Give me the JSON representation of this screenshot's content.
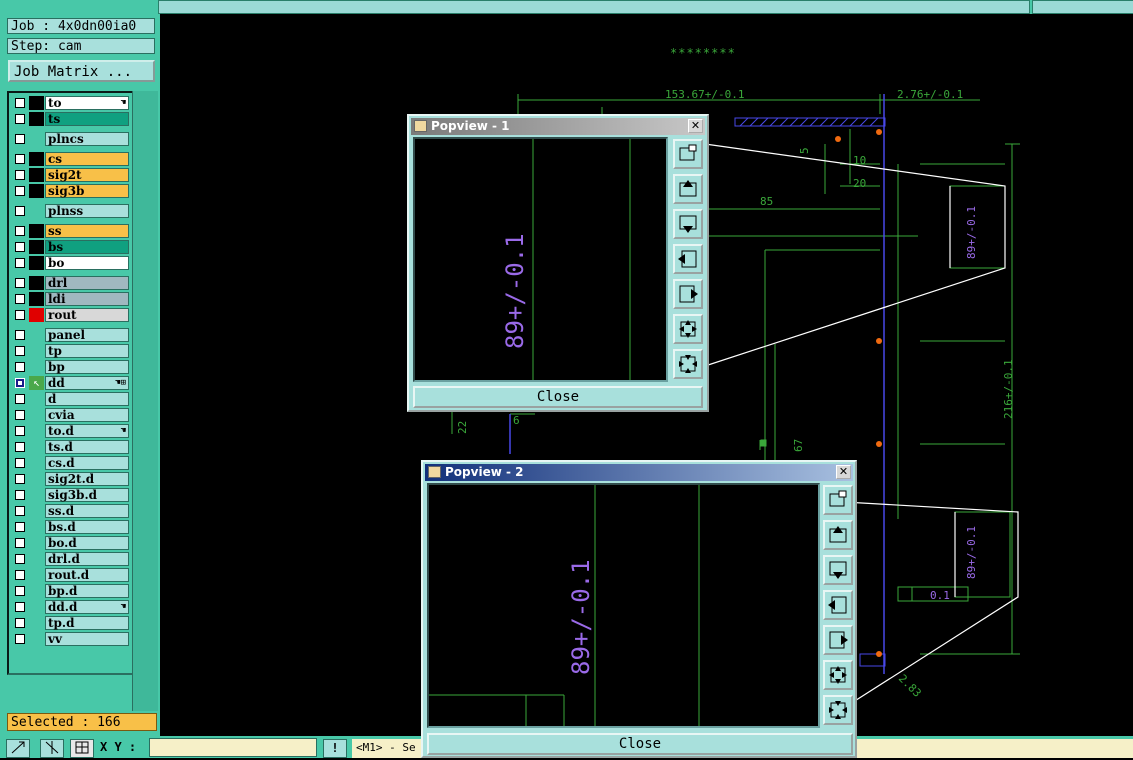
{
  "header": {
    "job": "Job : 4x0dn00ia0",
    "step": "Step: cam",
    "job_matrix": "Job Matrix ..."
  },
  "layers": [
    {
      "name": "to",
      "color": "#ffffff",
      "mark": "black",
      "tail": "hand"
    },
    {
      "name": "ts",
      "color": "#10a080",
      "mark": "black",
      "tail": ""
    },
    {
      "name": "plncs",
      "color": "#a8e0dc",
      "mark": "none",
      "tail": ""
    },
    {
      "name": "cs",
      "color": "#f8c048",
      "mark": "black",
      "tail": ""
    },
    {
      "name": "sig2t",
      "color": "#f8c048",
      "mark": "black",
      "tail": ""
    },
    {
      "name": "sig3b",
      "color": "#f8c048",
      "mark": "black",
      "tail": ""
    },
    {
      "name": "plnss",
      "color": "#a8e0dc",
      "mark": "none",
      "tail": ""
    },
    {
      "name": "ss",
      "color": "#f8c048",
      "mark": "black",
      "tail": ""
    },
    {
      "name": "bs",
      "color": "#10a080",
      "mark": "black",
      "tail": ""
    },
    {
      "name": "bo",
      "color": "#ffffff",
      "mark": "black",
      "tail": ""
    },
    {
      "name": "drl",
      "color": "#a0b8c0",
      "mark": "black",
      "tail": ""
    },
    {
      "name": "ldi",
      "color": "#a0b8c0",
      "mark": "black",
      "tail": ""
    },
    {
      "name": "rout",
      "color": "#d8d8d8",
      "mark": "red",
      "tail": ""
    },
    {
      "name": "panel",
      "color": "#a8e0dc",
      "mark": "none",
      "tail": ""
    },
    {
      "name": "tp",
      "color": "#a8e0dc",
      "mark": "none",
      "tail": ""
    },
    {
      "name": "bp",
      "color": "#a8e0dc",
      "mark": "none",
      "tail": ""
    },
    {
      "name": "dd",
      "color": "#a8e0dc",
      "mark": "arrow",
      "tail": "hand-grid",
      "selected": true
    },
    {
      "name": "d",
      "color": "#a8e0dc",
      "mark": "none",
      "tail": ""
    },
    {
      "name": "cvia",
      "color": "#a8e0dc",
      "mark": "none",
      "tail": ""
    },
    {
      "name": "to.d",
      "color": "#a8e0dc",
      "mark": "none",
      "tail": "hand"
    },
    {
      "name": "ts.d",
      "color": "#a8e0dc",
      "mark": "none",
      "tail": ""
    },
    {
      "name": "cs.d",
      "color": "#a8e0dc",
      "mark": "none",
      "tail": ""
    },
    {
      "name": "sig2t.d",
      "color": "#a8e0dc",
      "mark": "none",
      "tail": ""
    },
    {
      "name": "sig3b.d",
      "color": "#a8e0dc",
      "mark": "none",
      "tail": ""
    },
    {
      "name": "ss.d",
      "color": "#a8e0dc",
      "mark": "none",
      "tail": ""
    },
    {
      "name": "bs.d",
      "color": "#a8e0dc",
      "mark": "none",
      "tail": ""
    },
    {
      "name": "bo.d",
      "color": "#a8e0dc",
      "mark": "none",
      "tail": ""
    },
    {
      "name": "drl.d",
      "color": "#a8e0dc",
      "mark": "none",
      "tail": ""
    },
    {
      "name": "rout.d",
      "color": "#a8e0dc",
      "mark": "none",
      "tail": ""
    },
    {
      "name": "bp.d",
      "color": "#a8e0dc",
      "mark": "none",
      "tail": ""
    },
    {
      "name": "dd.d",
      "color": "#a8e0dc",
      "mark": "none",
      "tail": "hand"
    },
    {
      "name": "tp.d",
      "color": "#a8e0dc",
      "mark": "none",
      "tail": ""
    },
    {
      "name": "vv",
      "color": "#a8e0dc",
      "mark": "none",
      "tail": ""
    }
  ],
  "selected_count": "Selected : 166",
  "bottom": {
    "xy_label": "X Y :",
    "xy_value": "",
    "status": "<M1> - Se"
  },
  "drawing": {
    "stars": "********",
    "dim_top": "153.67+/-0.1",
    "dim_top_right": "2.76+/-0.1",
    "dim_85": "85",
    "dim_5": "5",
    "dim_10": "10",
    "dim_20": "20",
    "dim_89": "89+/-0.1",
    "dim_216": "216+/-0.1",
    "dim_22": "22",
    "dim_6": "6",
    "dim_67": "67",
    "dim_01": "0.1",
    "dim_283": "2.83"
  },
  "popview1": {
    "title": "Popview - 1",
    "view_text": "89+/-0.1",
    "close": "Close"
  },
  "popview2": {
    "title": "Popview - 2",
    "view_text": "89+/-0.1",
    "close": "Close"
  }
}
